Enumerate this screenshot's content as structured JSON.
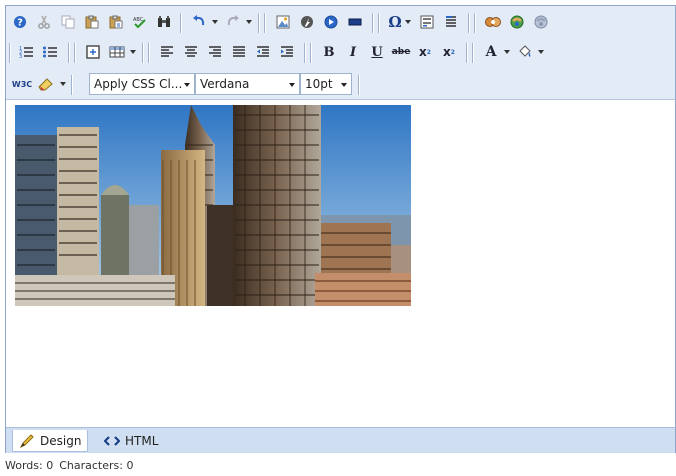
{
  "toolbar": {
    "row1": [
      {
        "name": "about-button",
        "icon": "help-icon"
      },
      {
        "name": "cut-button",
        "icon": "scissors-icon"
      },
      {
        "name": "copy-button",
        "icon": "copy-icon"
      },
      {
        "name": "paste-button",
        "icon": "paste-icon"
      },
      {
        "name": "paste-special-button",
        "icon": "paste-special-icon"
      },
      {
        "name": "spellcheck-button",
        "icon": "spellcheck-icon"
      },
      {
        "name": "find-button",
        "icon": "binoculars-icon"
      },
      {
        "name": "undo-button",
        "icon": "undo-icon"
      },
      {
        "name": "redo-button",
        "icon": "redo-icon"
      },
      {
        "name": "insert-image-button",
        "icon": "image-icon"
      },
      {
        "name": "insert-flash-button",
        "icon": "flash-icon"
      },
      {
        "name": "insert-media-button",
        "icon": "media-icon"
      },
      {
        "name": "insert-horizontal-rule-button",
        "icon": "rule-icon"
      },
      {
        "name": "insert-symbol-button",
        "icon": "omega-icon"
      },
      {
        "name": "insert-form-button",
        "icon": "form-icon"
      },
      {
        "name": "paragraph-button",
        "icon": "paragraph-icon"
      },
      {
        "name": "insert-link-button",
        "icon": "link-icon"
      },
      {
        "name": "insert-anchor-button",
        "icon": "anchor-icon"
      },
      {
        "name": "remove-link-button",
        "icon": "unlink-icon"
      }
    ],
    "row2": [
      {
        "name": "ordered-list-button",
        "icon": "numbered-list-icon"
      },
      {
        "name": "unordered-list-button",
        "icon": "bullet-list-icon"
      },
      {
        "name": "insert-box-button",
        "icon": "box-icon"
      },
      {
        "name": "insert-table-button",
        "icon": "table-icon"
      },
      {
        "name": "align-left-button",
        "icon": "align-left-icon"
      },
      {
        "name": "align-center-button",
        "icon": "align-center-icon"
      },
      {
        "name": "align-right-button",
        "icon": "align-right-icon"
      },
      {
        "name": "justify-button",
        "icon": "justify-icon"
      },
      {
        "name": "outdent-button",
        "icon": "outdent-icon"
      },
      {
        "name": "indent-button",
        "icon": "indent-icon"
      },
      {
        "name": "bold-button",
        "label": "B"
      },
      {
        "name": "italic-button",
        "label": "I"
      },
      {
        "name": "underline-button",
        "label": "U"
      },
      {
        "name": "strikethrough-button",
        "label": "abe"
      },
      {
        "name": "subscript-button",
        "label": "x"
      },
      {
        "name": "superscript-button",
        "label": "x"
      },
      {
        "name": "font-color-button",
        "label": "A"
      },
      {
        "name": "highlight-color-button",
        "icon": "paint-bucket-icon"
      }
    ],
    "row3": {
      "w3c_label": "W3C",
      "css_class_select": "Apply CSS Cl...",
      "font_name_select": "Verdana",
      "font_size_select": "10pt"
    },
    "sub_label": "2",
    "sup_label": "2"
  },
  "modes": {
    "design_label": "Design",
    "html_label": "HTML"
  },
  "status": {
    "words": "Words: 0",
    "characters": "Characters: 0"
  },
  "colors": {
    "toolbar_bg": "#e2ebf6",
    "modebar_bg": "#cfdff1",
    "border": "#8fa6c8"
  }
}
